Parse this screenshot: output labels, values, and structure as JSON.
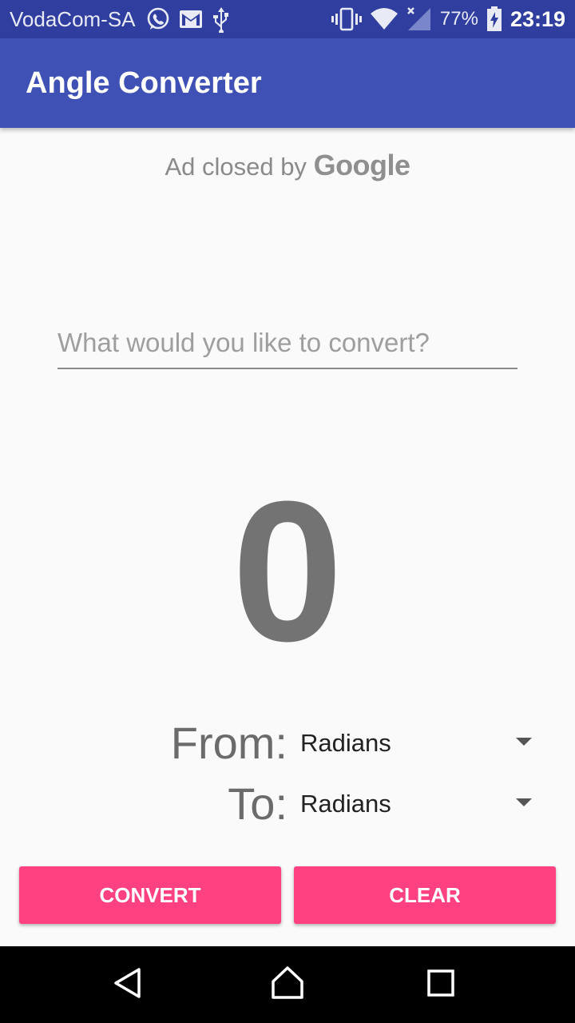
{
  "status_bar": {
    "carrier": "VodaCom-SA",
    "battery_percent": "77%",
    "time": "23:19",
    "icons": [
      "whatsapp-icon",
      "gmail-icon",
      "usb-icon",
      "vibrate-icon",
      "wifi-icon",
      "signal-icon",
      "battery-charging-icon"
    ]
  },
  "app_bar": {
    "title": "Angle Converter",
    "color": "#3f51b5"
  },
  "ad": {
    "text": "Ad closed by",
    "brand": "Google"
  },
  "input": {
    "placeholder": "What would you like to convert?",
    "value": ""
  },
  "result": {
    "value": "0"
  },
  "from": {
    "label": "From:",
    "selected": "Radians"
  },
  "to": {
    "label": "To:",
    "selected": "Radians"
  },
  "buttons": {
    "convert": "CONVERT",
    "clear": "CLEAR",
    "color": "#ff4081"
  },
  "nav": {
    "icons": [
      "back-icon",
      "home-icon",
      "recents-icon"
    ]
  }
}
